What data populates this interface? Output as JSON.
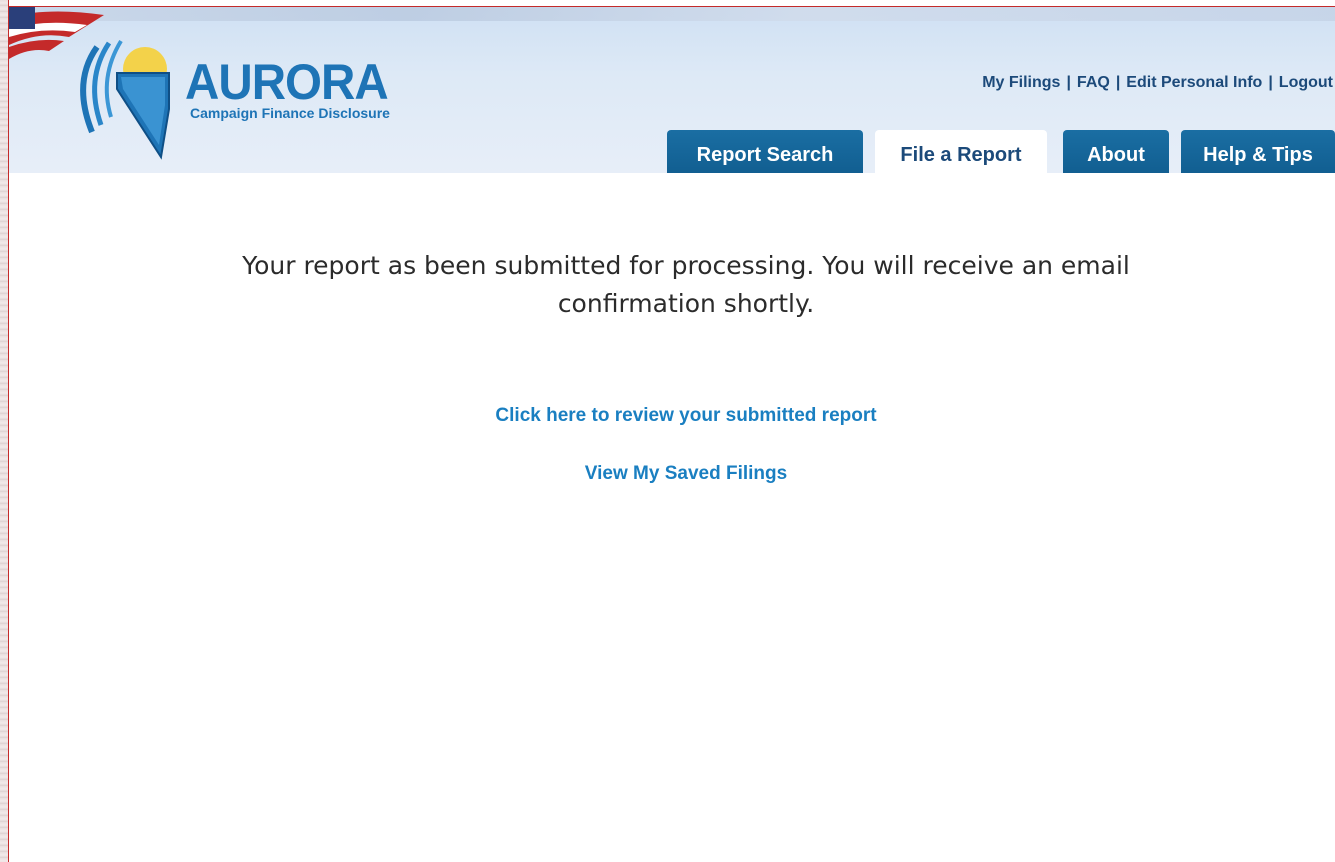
{
  "logo": {
    "wordmark": "AURORA",
    "subtitle": "Campaign Finance Disclosure"
  },
  "top_links": [
    {
      "label": "My Filings"
    },
    {
      "label": "FAQ"
    },
    {
      "label": "Edit Personal Info"
    },
    {
      "label": "Logout"
    }
  ],
  "top_links_separator": "|",
  "tabs": [
    {
      "label": "Report Search",
      "active": false
    },
    {
      "label": "File a Report",
      "active": true
    },
    {
      "label": "About",
      "active": false
    },
    {
      "label": "Help & Tips",
      "active": false
    }
  ],
  "main": {
    "message": "Your report as been submitted for processing. You will receive an email confirmation shortly.",
    "review_link": "Click here to review your submitted report",
    "saved_filings_link": "View My Saved Filings"
  },
  "colors": {
    "brand_blue": "#1e74b6",
    "tab_blue": "#105c8e",
    "link_blue": "#1a7fc1",
    "frame_red": "#c42a2a"
  }
}
